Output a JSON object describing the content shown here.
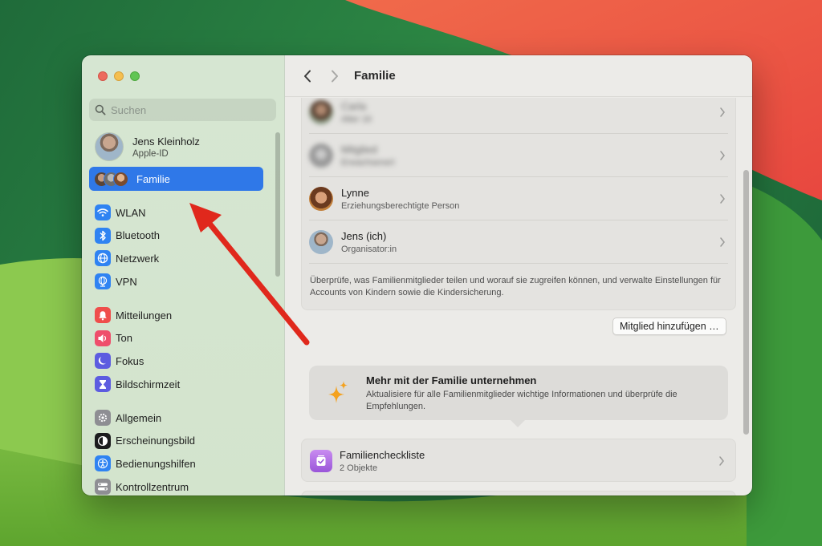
{
  "window": {
    "title": "Familie"
  },
  "sidebar": {
    "search_placeholder": "Suchen",
    "profile": {
      "name": "Jens Kleinholz",
      "subtitle": "Apple-ID"
    },
    "family_item": {
      "label": "Familie",
      "selected": true,
      "accent_color": "#2f78e8"
    },
    "groups": [
      {
        "items": [
          {
            "label": "WLAN",
            "icon": "wifi-icon",
            "color": "#2f83f2"
          },
          {
            "label": "Bluetooth",
            "icon": "bluetooth-icon",
            "color": "#2f83f2"
          },
          {
            "label": "Netzwerk",
            "icon": "globe-icon",
            "color": "#2f83f2"
          },
          {
            "label": "VPN",
            "icon": "vpn-globe-icon",
            "color": "#2f83f2"
          }
        ]
      },
      {
        "items": [
          {
            "label": "Mitteilungen",
            "icon": "bell-icon",
            "color": "#ef4e4b"
          },
          {
            "label": "Ton",
            "icon": "speaker-icon",
            "color": "#ef4e6b"
          },
          {
            "label": "Fokus",
            "icon": "moon-icon",
            "color": "#5d5ce0"
          },
          {
            "label": "Bildschirmzeit",
            "icon": "hourglass-icon",
            "color": "#5d5ce0"
          }
        ]
      },
      {
        "items": [
          {
            "label": "Allgemein",
            "icon": "gear-icon",
            "color": "#8e8e93"
          },
          {
            "label": "Erscheinungsbild",
            "icon": "appearance-icon",
            "color": "#1c1c1e"
          },
          {
            "label": "Bedienungshilfen",
            "icon": "accessibility-icon",
            "color": "#2f83f2"
          },
          {
            "label": "Kontrollzentrum",
            "icon": "control-center-icon",
            "color": "#8e8e93"
          }
        ]
      }
    ]
  },
  "main": {
    "members": [
      {
        "name": "Carla",
        "role": "Alter 16",
        "blurred": true
      },
      {
        "name": "Mitglied",
        "role": "Erwachsene/r",
        "blurred": true
      },
      {
        "name": "Lynne",
        "role": "Erziehungsberechtigte Person",
        "blurred": false
      },
      {
        "name": "Jens (ich)",
        "role": "Organisator:in",
        "blurred": false
      }
    ],
    "description": "Überprüfe, was Familienmitglieder teilen und worauf sie zugreifen können, und verwalte Einstellungen für Accounts von Kindern sowie die Kindersicherung.",
    "add_member_button": "Mitglied hinzufügen …",
    "tip": {
      "title": "Mehr mit der Familie unternehmen",
      "body": "Aktualisiere für alle Familienmitglieder wichtige Informationen und überprüfe die Empfehlungen."
    },
    "checklist": {
      "title": "Familiencheckliste",
      "subtitle": "2 Objekte"
    }
  },
  "annotation": {
    "arrow_color": "#e0281c"
  }
}
